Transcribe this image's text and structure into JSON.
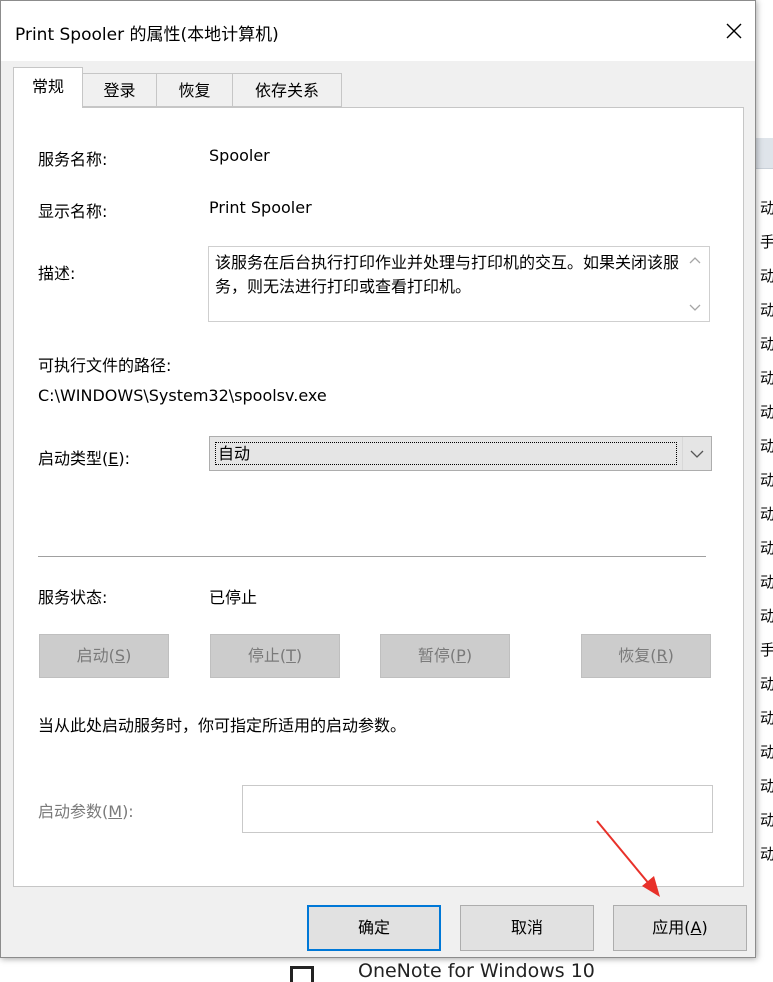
{
  "background": {
    "right_column_chars": [
      "动",
      "手",
      "动",
      "动",
      "动",
      "动",
      "动",
      "动",
      "动",
      "动",
      "动",
      "动",
      "动",
      "手",
      "动",
      "动",
      "动",
      "动",
      "动",
      "动"
    ],
    "bottom_item_text": "OneNote for Windows 10"
  },
  "dialog": {
    "title": "Print Spooler 的属性(本地计算机)",
    "close_label": "✕",
    "tabs": [
      {
        "label": "常规",
        "active": true
      },
      {
        "label": "登录",
        "active": false
      },
      {
        "label": "恢复",
        "active": false
      },
      {
        "label": "依存关系",
        "active": false
      }
    ],
    "general": {
      "service_name_label": "服务名称:",
      "service_name_value": "Spooler",
      "display_name_label": "显示名称:",
      "display_name_value": "Print Spooler",
      "description_label": "描述:",
      "description_value": "该服务在后台执行打印作业并处理与打印机的交互。如果关闭该服务，则无法进行打印或查看打印机。",
      "exe_path_label": "可执行文件的路径:",
      "exe_path_value": "C:\\WINDOWS\\System32\\spoolsv.exe",
      "startup_type_label_pre": "启动类型(",
      "startup_type_label_key": "E",
      "startup_type_label_post": "):",
      "startup_type_value": "自动",
      "service_status_label": "服务状态:",
      "service_status_value": "已停止",
      "buttons": [
        {
          "pre": "启动(",
          "key": "S",
          "post": ")",
          "enabled": false
        },
        {
          "pre": "停止(",
          "key": "T",
          "post": ")",
          "enabled": false
        },
        {
          "pre": "暂停(",
          "key": "P",
          "post": ")",
          "enabled": false
        },
        {
          "pre": "恢复(",
          "key": "R",
          "post": ")",
          "enabled": false
        }
      ],
      "hint_text": "当从此处启动服务时，你可指定所适用的启动参数。",
      "start_params_label_pre": "启动参数(",
      "start_params_label_key": "M",
      "start_params_label_post": "):",
      "start_params_value": ""
    },
    "footer": {
      "ok_label": "确定",
      "cancel_label": "取消",
      "apply_label_pre": "应用(",
      "apply_label_key": "A",
      "apply_label_post": ")"
    }
  },
  "colors": {
    "focus_border": "#0078d7",
    "annotation_arrow": "#e8312a",
    "disabled_button": "#cccccc"
  }
}
